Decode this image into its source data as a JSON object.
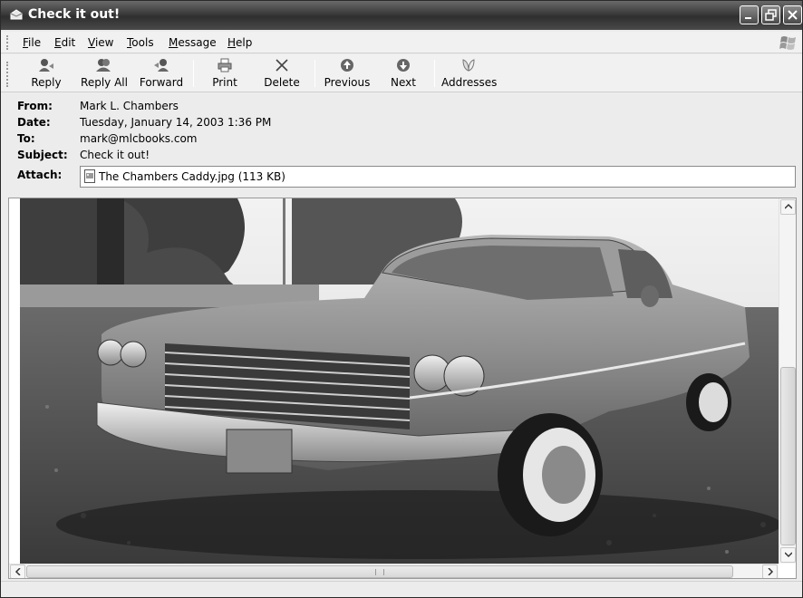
{
  "window": {
    "title": "Check it out!"
  },
  "menu": {
    "items": [
      {
        "label": "File"
      },
      {
        "label": "Edit"
      },
      {
        "label": "View"
      },
      {
        "label": "Tools"
      },
      {
        "label": "Message"
      },
      {
        "label": "Help"
      }
    ]
  },
  "toolbar": {
    "reply": {
      "label": "Reply",
      "icon": "reply-icon"
    },
    "reply_all": {
      "label": "Reply All",
      "icon": "reply-all-icon"
    },
    "forward": {
      "label": "Forward",
      "icon": "forward-icon"
    },
    "print": {
      "label": "Print",
      "icon": "printer-icon"
    },
    "delete": {
      "label": "Delete",
      "icon": "delete-x-icon"
    },
    "previous": {
      "label": "Previous",
      "icon": "up-arrow-circle-icon"
    },
    "next": {
      "label": "Next",
      "icon": "down-arrow-circle-icon"
    },
    "addresses": {
      "label": "Addresses",
      "icon": "address-book-icon"
    }
  },
  "message": {
    "from_label": "From:",
    "from": "Mark L. Chambers",
    "date_label": "Date:",
    "date": "Tuesday, January 14, 2003 1:36 PM",
    "to_label": "To:",
    "to": "mark@mlcbooks.com",
    "subject_label": "Subject:",
    "subject": "Check it out!",
    "attach_label": "Attach:",
    "attachment": "The Chambers Caddy.jpg (113 KB)"
  },
  "colors": {
    "titlebar": "#3a3a3a",
    "chrome": "#ececec"
  }
}
